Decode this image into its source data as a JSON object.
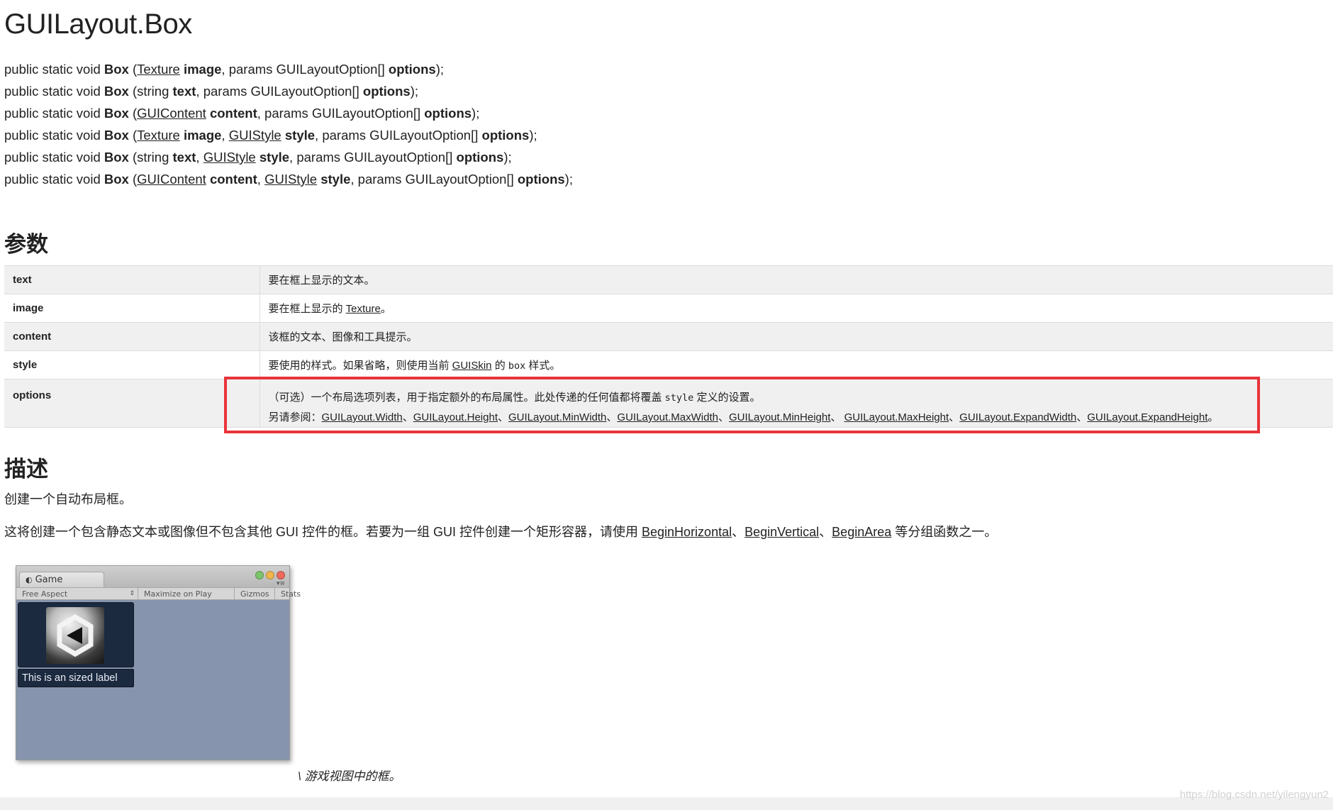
{
  "title": "GUILayout.Box",
  "signatures": [
    {
      "prefix": "public static void ",
      "name": "Box",
      "parts": [
        {
          "t": "text",
          "v": " ("
        },
        {
          "t": "link",
          "v": "Texture"
        },
        {
          "t": "text",
          "v": " "
        },
        {
          "t": "bold",
          "v": "image"
        },
        {
          "t": "text",
          "v": ", params GUILayoutOption[] "
        },
        {
          "t": "bold",
          "v": "options"
        },
        {
          "t": "text",
          "v": ");"
        }
      ]
    },
    {
      "prefix": "public static void ",
      "name": "Box",
      "parts": [
        {
          "t": "text",
          "v": " (string "
        },
        {
          "t": "bold",
          "v": "text"
        },
        {
          "t": "text",
          "v": ", params GUILayoutOption[] "
        },
        {
          "t": "bold",
          "v": "options"
        },
        {
          "t": "text",
          "v": ");"
        }
      ]
    },
    {
      "prefix": "public static void ",
      "name": "Box",
      "parts": [
        {
          "t": "text",
          "v": " ("
        },
        {
          "t": "link",
          "v": "GUIContent"
        },
        {
          "t": "text",
          "v": " "
        },
        {
          "t": "bold",
          "v": "content"
        },
        {
          "t": "text",
          "v": ", params GUILayoutOption[] "
        },
        {
          "t": "bold",
          "v": "options"
        },
        {
          "t": "text",
          "v": ");"
        }
      ]
    },
    {
      "prefix": "public static void ",
      "name": "Box",
      "parts": [
        {
          "t": "text",
          "v": " ("
        },
        {
          "t": "link",
          "v": "Texture"
        },
        {
          "t": "text",
          "v": " "
        },
        {
          "t": "bold",
          "v": "image"
        },
        {
          "t": "text",
          "v": ", "
        },
        {
          "t": "link",
          "v": "GUIStyle"
        },
        {
          "t": "text",
          "v": " "
        },
        {
          "t": "bold",
          "v": "style"
        },
        {
          "t": "text",
          "v": ", params GUILayoutOption[] "
        },
        {
          "t": "bold",
          "v": "options"
        },
        {
          "t": "text",
          "v": ");"
        }
      ]
    },
    {
      "prefix": "public static void ",
      "name": "Box",
      "parts": [
        {
          "t": "text",
          "v": " (string "
        },
        {
          "t": "bold",
          "v": "text"
        },
        {
          "t": "text",
          "v": ", "
        },
        {
          "t": "link",
          "v": "GUIStyle"
        },
        {
          "t": "text",
          "v": " "
        },
        {
          "t": "bold",
          "v": "style"
        },
        {
          "t": "text",
          "v": ", params GUILayoutOption[] "
        },
        {
          "t": "bold",
          "v": "options"
        },
        {
          "t": "text",
          "v": ");"
        }
      ]
    },
    {
      "prefix": "public static void ",
      "name": "Box",
      "parts": [
        {
          "t": "text",
          "v": " ("
        },
        {
          "t": "link",
          "v": "GUIContent"
        },
        {
          "t": "text",
          "v": " "
        },
        {
          "t": "bold",
          "v": "content"
        },
        {
          "t": "text",
          "v": ", "
        },
        {
          "t": "link",
          "v": "GUIStyle"
        },
        {
          "t": "text",
          "v": " "
        },
        {
          "t": "bold",
          "v": "style"
        },
        {
          "t": "text",
          "v": ", params GUILayoutOption[] "
        },
        {
          "t": "bold",
          "v": "options"
        },
        {
          "t": "text",
          "v": ");"
        }
      ]
    }
  ],
  "params_heading": "参数",
  "params": {
    "text": {
      "name": "text",
      "desc": "要在框上显示的文本。"
    },
    "image": {
      "name": "image",
      "desc_before": "要在框上显示的 ",
      "link": "Texture",
      "desc_after": "。"
    },
    "content": {
      "name": "content",
      "desc": "该框的文本、图像和工具提示。"
    },
    "style": {
      "name": "style",
      "desc_before": "要使用的样式。如果省略，则使用当前 ",
      "link": "GUISkin",
      "desc_mid": " 的 ",
      "code": "box",
      "desc_after": " 样式。"
    },
    "options": {
      "name": "options",
      "line1_before": "（可选）一个布局选项列表，用于指定额外的布局属性。此处传递的任何值都将覆盖 ",
      "line1_code": "style",
      "line1_after": " 定义的设置。",
      "see_also": "另请参阅：",
      "links": [
        "GUILayout.Width",
        "GUILayout.Height",
        "GUILayout.MinWidth",
        "GUILayout.MaxWidth",
        "GUILayout.MinHeight",
        "GUILayout.MaxHeight",
        "GUILayout.ExpandWidth",
        "GUILayout.ExpandHeight"
      ],
      "separators": [
        "、",
        "、",
        "、",
        "、",
        "、 ",
        "、",
        "、",
        "。"
      ]
    }
  },
  "description_heading": "描述",
  "description": {
    "line1": "创建一个自动布局框。",
    "line2_before": "这将创建一个包含静态文本或图像但不包含其他 GUI 控件的框。若要为一组 GUI 控件创建一个矩形容器，请使用 ",
    "link1": "BeginHorizontal",
    "sep1": "、",
    "link2": "BeginVertical",
    "sep2": "、",
    "link3": "BeginArea",
    "line2_after": " 等分组函数之一。"
  },
  "game_window": {
    "tab_label": "Game",
    "aspect": "Free Aspect",
    "maximize": "Maximize on Play",
    "gizmos": "Gizmos",
    "stats": "Stats",
    "label_text": "This is an sized label"
  },
  "caption": "\\ 游戏视图中的框。",
  "watermark": "https://blog.csdn.net/yilengyun2",
  "colors": {
    "highlight": "#e8343a",
    "game_bg": "#8794ad",
    "gui_box": "#1c2a40"
  }
}
